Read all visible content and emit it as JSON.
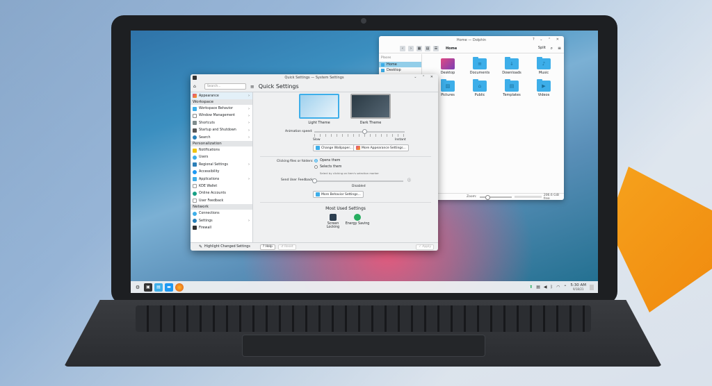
{
  "dolphin": {
    "title": "Home — Dolphin",
    "home": "Home",
    "split": "Split",
    "places_label": "Places",
    "places": [
      "Home",
      "Desktop"
    ],
    "items": [
      {
        "name": "Desktop",
        "icon": "desktop-folder-icon",
        "glyph": ""
      },
      {
        "name": "Documents",
        "icon": "documents-folder-icon",
        "glyph": "≡"
      },
      {
        "name": "Downloads",
        "icon": "downloads-folder-icon",
        "glyph": "↓"
      },
      {
        "name": "Music",
        "icon": "music-folder-icon",
        "glyph": "♪"
      },
      {
        "name": "Pictures",
        "icon": "pictures-folder-icon",
        "glyph": "▨"
      },
      {
        "name": "Public",
        "icon": "public-folder-icon",
        "glyph": "⌂"
      },
      {
        "name": "Templates",
        "icon": "templates-folder-icon",
        "glyph": "▤"
      },
      {
        "name": "Videos",
        "icon": "videos-folder-icon",
        "glyph": "▶"
      }
    ],
    "zoom_label": "Zoom:",
    "free_space": "206.6 GiB free"
  },
  "settings": {
    "title": "Quick Settings — System Settings",
    "search_placeholder": "Search...",
    "heading": "Quick Settings",
    "sidebar": {
      "top_item": "Appearance",
      "workspace_label": "Workspace",
      "workspace": [
        "Workspace Behavior",
        "Window Management",
        "Shortcuts",
        "Startup and Shutdown",
        "Search"
      ],
      "personalization_label": "Personalization",
      "personalization": [
        "Notifications",
        "Users",
        "Regional Settings",
        "Accessibility",
        "Applications",
        "KDE Wallet",
        "Online Accounts",
        "User Feedback"
      ],
      "network_label": "Network",
      "network": [
        "Connections",
        "Settings",
        "Firewall"
      ]
    },
    "themes": {
      "light": "Light Theme",
      "dark": "Dark Theme"
    },
    "animation_speed_label": "Animation speed:",
    "slow_label": "Slow",
    "instant_label": "Instant",
    "animation_speed_level": 0.55,
    "change_wallpaper": "Change Wallpaper...",
    "more_appearance": "More Appearance Settings...",
    "clicking_label": "Clicking files or folders:",
    "opens_them": "Opens them",
    "selects_them": "Selects them",
    "select_hint": "Select by clicking on item's selection marker",
    "feedback_label": "Send User Feedback:",
    "feedback_value": "Disabled",
    "feedback_level": 0,
    "more_behavior": "More Behavior Settings...",
    "most_used_title": "Most Used Settings",
    "most_used": [
      "Screen Locking",
      "Energy Saving"
    ],
    "highlight_changed": "Highlight Changed Settings",
    "help": "Help",
    "reset": "Reset",
    "apply": "Apply"
  },
  "taskbar": {
    "time": "5:30 AM",
    "date": "9/18/21"
  }
}
